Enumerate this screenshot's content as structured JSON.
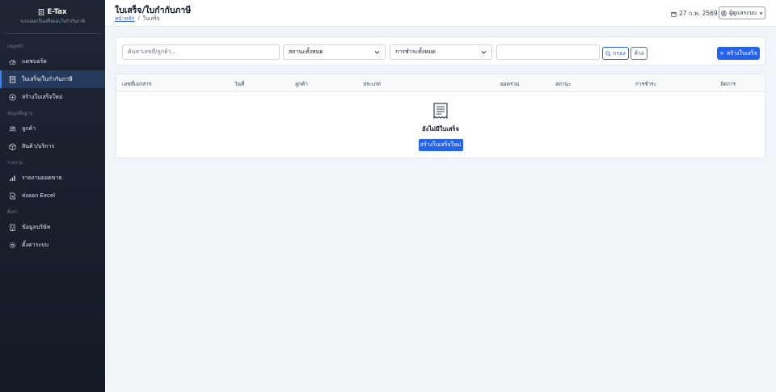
{
  "brand": {
    "title": "E-Tax",
    "subtitle": "ระบบออกใบเสร็จและใบกำกับภาษี"
  },
  "sidebar": {
    "sections": [
      {
        "label": "เมนูหลัก",
        "items": [
          {
            "label": "แดชบอร์ด",
            "icon": "dashboard-icon"
          },
          {
            "label": "ใบเสร็จ/ใบกำกับภาษี",
            "icon": "receipt-icon",
            "active": true
          },
          {
            "label": "สร้างใบเสร็จใหม่",
            "icon": "plus-circle-icon"
          }
        ]
      },
      {
        "label": "ข้อมูลพื้นฐาน",
        "items": [
          {
            "label": "ลูกค้า",
            "icon": "people-icon"
          },
          {
            "label": "สินค้า/บริการ",
            "icon": "box-icon"
          }
        ]
      },
      {
        "label": "รายงาน",
        "items": [
          {
            "label": "รายงานยอดขาย",
            "icon": "bar-chart-icon"
          },
          {
            "label": "ส่งออก Excel",
            "icon": "file-excel-icon"
          }
        ]
      },
      {
        "label": "ตั้งค่า",
        "items": [
          {
            "label": "ข้อมูลบริษัท",
            "icon": "building-icon"
          },
          {
            "label": "ตั้งค่าระบบ",
            "icon": "gear-icon"
          }
        ]
      }
    ]
  },
  "header": {
    "title": "ใบเสร็จ/ใบกำกับภาษี",
    "breadcrumb": {
      "home": "หน้าหลัก",
      "separator": "/",
      "current": "ใบเสร็จ"
    },
    "date": "27 ก.พ. 2569",
    "user": "ผู้ดูแลระบบ"
  },
  "filters": {
    "search_placeholder": "ค้นหาเลขที่/ลูกค้า...",
    "status_value": "สถานะทั้งหมด",
    "payment_value": "การชำระทั้งหมด",
    "date_value": "",
    "filter_label": "กรอง",
    "clear_label": "ล้าง",
    "create_label": "สร้างใบเสร็จ"
  },
  "table": {
    "columns": [
      "เลขที่เอกสาร",
      "วันที่",
      "ลูกค้า",
      "ประเภท",
      "ยอดรวม",
      "สถานะ",
      "การชำระ",
      "จัดการ"
    ],
    "empty_text": "ยังไม่มีใบเสร็จ",
    "empty_button": "สร้างใบเสร็จใหม่"
  },
  "colors": {
    "accent": "#2563eb",
    "sidebar": "#1e2633",
    "active_item": "#263a5e"
  }
}
